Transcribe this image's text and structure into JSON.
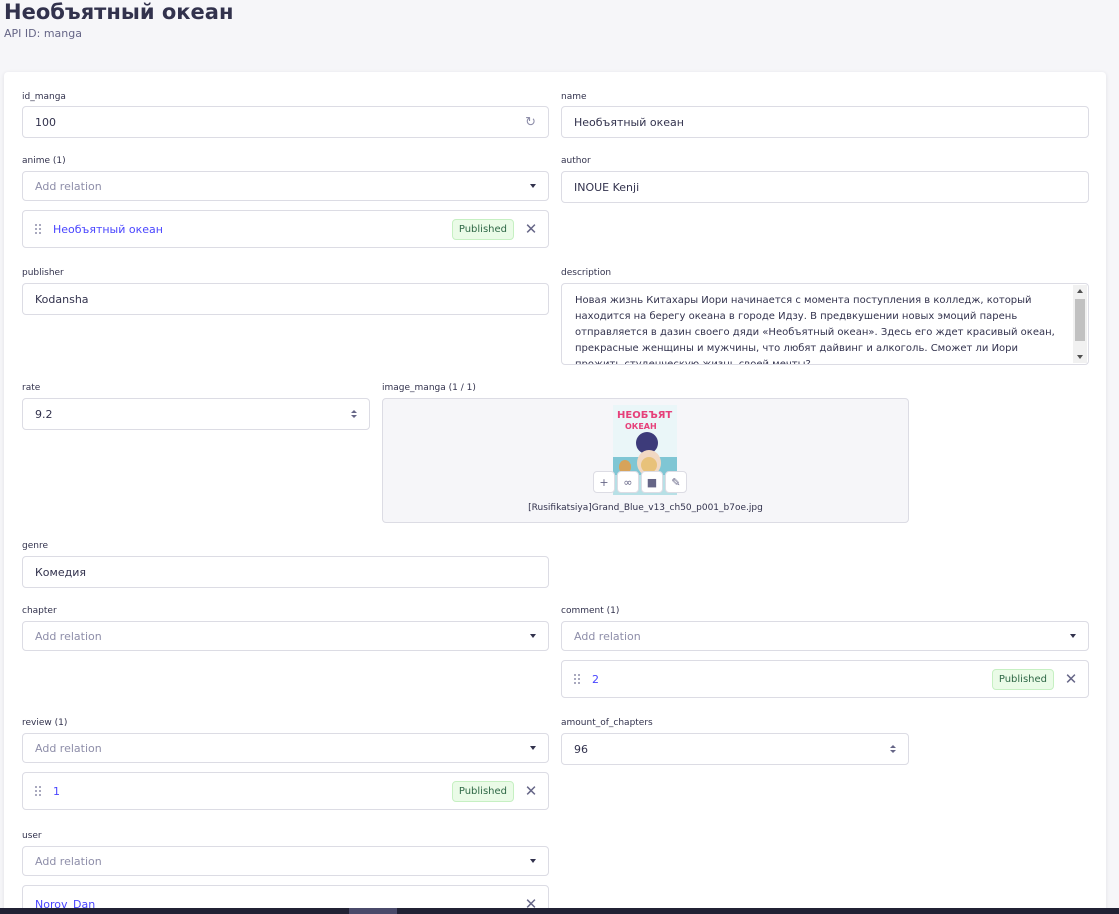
{
  "header": {
    "title": "Необъятный океан",
    "api_id": "API ID: manga"
  },
  "fields": {
    "id_manga": {
      "label": "id_manga",
      "value": "100"
    },
    "name": {
      "label": "name",
      "value": "Необъятный океан"
    },
    "anime": {
      "label": "anime (1)",
      "placeholder": "Add relation",
      "items": [
        {
          "label": "Необъятный океан",
          "status": "Published"
        }
      ]
    },
    "author": {
      "label": "author",
      "value": "INOUE Kenji"
    },
    "publisher": {
      "label": "publisher",
      "value": "Kodansha"
    },
    "description": {
      "label": "description",
      "value": "Новая жизнь Китахары Иори начинается с момента поступления в колледж, который находится на берегу океана в городе Идзу. В предвкушении новых эмоций парень отправляется в дазин своего дяди «Необъятный океан». Здесь его ждет красивый океан, прекрасные женщины и мужчины, что любят дайвинг и алкоголь. Сможет ли Иори прожить студенческую жизнь своей мечты?"
    },
    "rate": {
      "label": "rate",
      "value": "9.2"
    },
    "image_manga": {
      "label": "image_manga (1 / 1)",
      "filename": "[Rusifikatsiya]Grand_Blue_v13_ch50_p001_b7oe.jpg"
    },
    "genre": {
      "label": "genre",
      "value": "Комедия"
    },
    "chapter": {
      "label": "chapter",
      "placeholder": "Add relation"
    },
    "comment": {
      "label": "comment (1)",
      "placeholder": "Add relation",
      "items": [
        {
          "label": "2",
          "status": "Published"
        }
      ]
    },
    "review": {
      "label": "review (1)",
      "placeholder": "Add relation",
      "items": [
        {
          "label": "1",
          "status": "Published"
        }
      ]
    },
    "amount_of_chapters": {
      "label": "amount_of_chapters",
      "value": "96"
    },
    "user": {
      "label": "user",
      "placeholder": "Add relation",
      "items": [
        {
          "label": "Norov_Dan"
        }
      ]
    }
  },
  "icons": {
    "refresh": "refresh-icon",
    "caret": "chevron-down-icon",
    "close": "close-icon",
    "drag": "drag-handle-icon",
    "add": "plus-icon",
    "link": "link-icon",
    "delete": "trash-icon",
    "edit": "pencil-icon"
  },
  "colors": {
    "primary": "#4945ff",
    "success_bg": "#eafbe7",
    "success_text": "#2f6846",
    "border": "#dcdce4",
    "background": "#f6f6f9"
  }
}
